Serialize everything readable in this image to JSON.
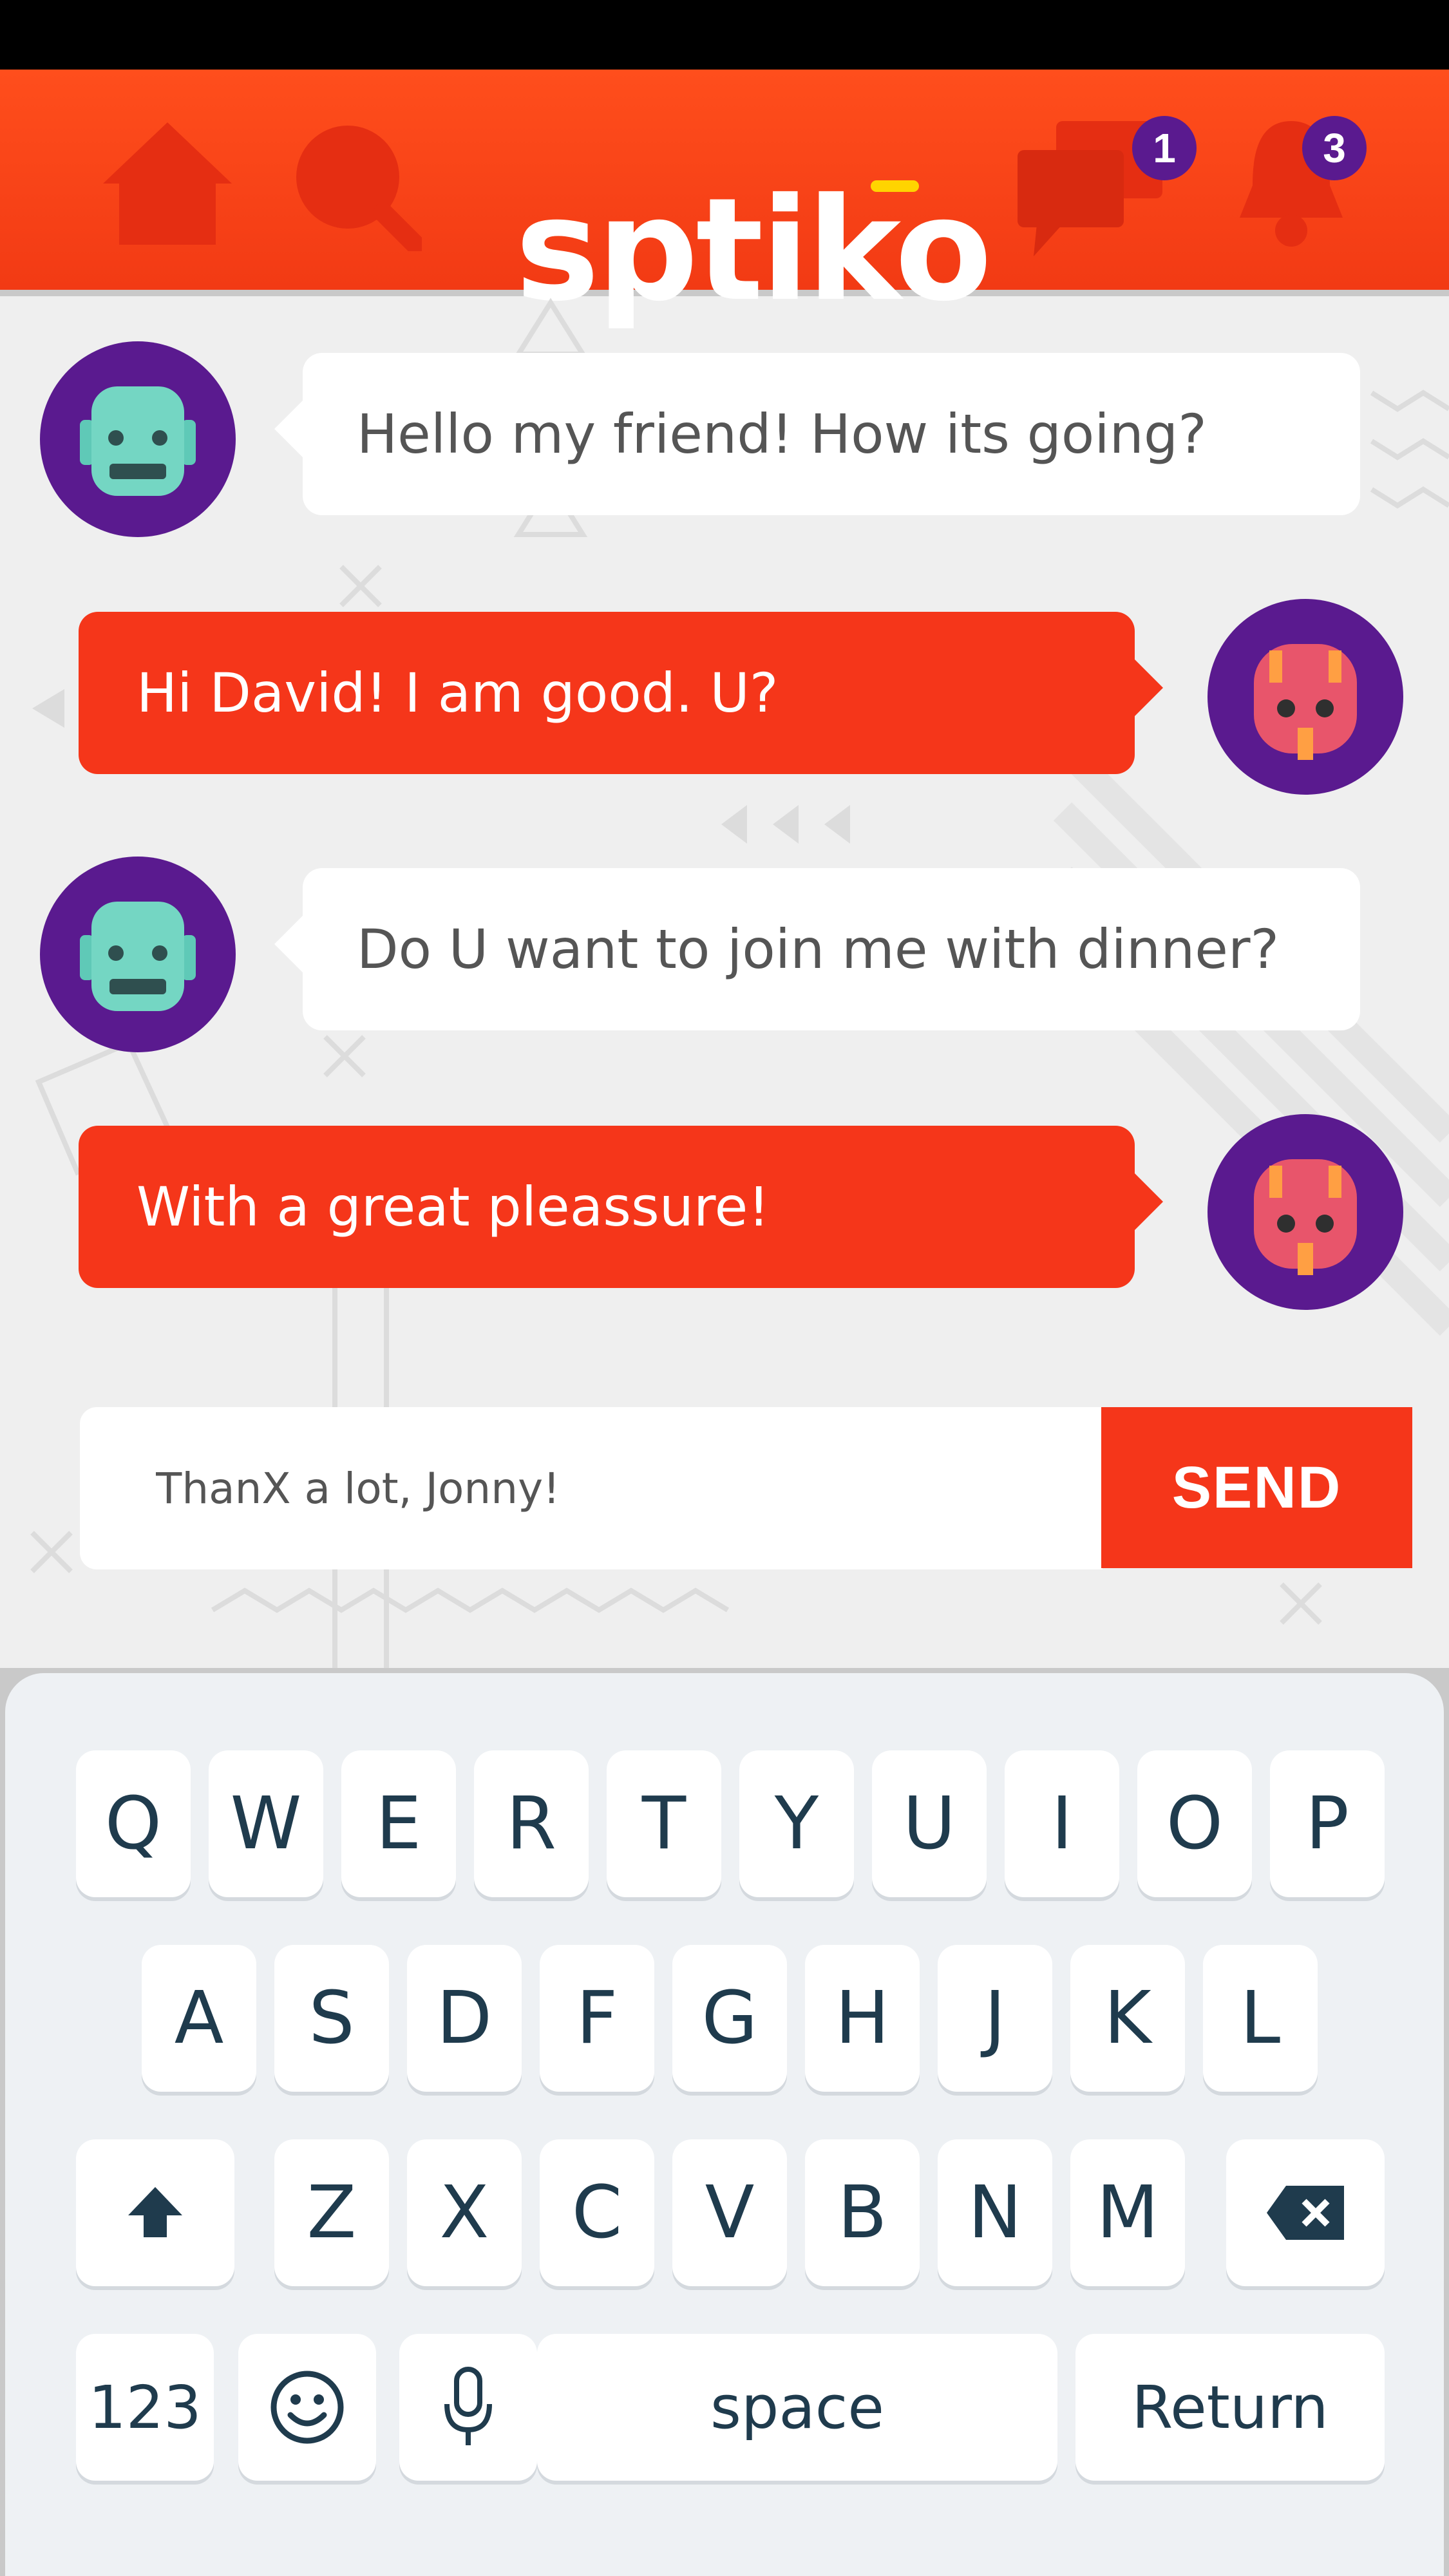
{
  "app": {
    "name": "sptiko"
  },
  "header": {
    "messages_badge": "1",
    "notifications_badge": "3",
    "colors": {
      "bar": "#f5361a",
      "badge": "#5a1a8f",
      "logo_accent": "#ffd400"
    }
  },
  "messages": [
    {
      "sender": "friend",
      "text": "Hello my friend! How its going?"
    },
    {
      "sender": "me",
      "text": "Hi David! I am good. U?"
    },
    {
      "sender": "friend",
      "text": "Do U want to join me with dinner?"
    },
    {
      "sender": "me",
      "text": "With a great pleassure!"
    }
  ],
  "composer": {
    "value": "ThanX a lot, Jonny!",
    "send_label": "SEND"
  },
  "keyboard": {
    "row1": [
      "Q",
      "W",
      "E",
      "R",
      "T",
      "Y",
      "U",
      "I",
      "O",
      "P"
    ],
    "row2": [
      "A",
      "S",
      "D",
      "F",
      "G",
      "H",
      "J",
      "K",
      "L"
    ],
    "row3": [
      "Z",
      "X",
      "C",
      "V",
      "B",
      "N",
      "M"
    ],
    "numbers_label": "123",
    "space_label": "space",
    "return_label": "Return"
  }
}
